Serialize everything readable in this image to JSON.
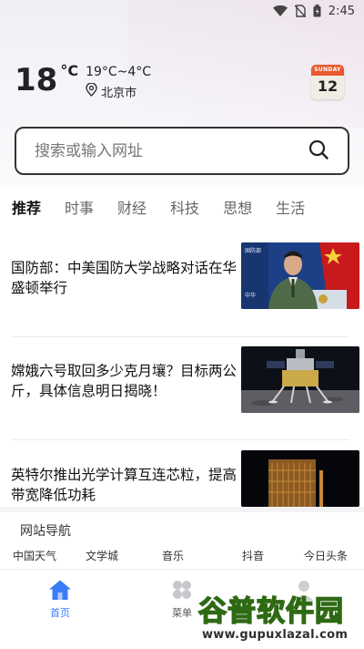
{
  "status_bar": {
    "time": "2:45"
  },
  "weather": {
    "temperature": "18",
    "degree_unit": "°C",
    "range": "19°C~4°C",
    "location": "北京市"
  },
  "calendar": {
    "weekday": "SUNDAY",
    "day": "12"
  },
  "search": {
    "placeholder": "搜索或输入网址"
  },
  "tabs": [
    {
      "label": "推荐",
      "active": true
    },
    {
      "label": "时事",
      "active": false
    },
    {
      "label": "财经",
      "active": false
    },
    {
      "label": "科技",
      "active": false
    },
    {
      "label": "思想",
      "active": false
    },
    {
      "label": "生活",
      "active": false
    }
  ],
  "news": [
    {
      "title": "国防部：中美国防大学战略对话在华盛顿举行",
      "thumb_icon": "press-conference-photo"
    },
    {
      "title": "嫦娥六号取回多少克月壤？目标两公斤，具体信息明日揭晓！",
      "thumb_icon": "lunar-lander-photo"
    },
    {
      "title": "英特尔推出光学计算互连芯粒，提高带宽降低功耗",
      "thumb_icon": "chip-photo"
    }
  ],
  "site_nav": {
    "title": "网站导航",
    "links": [
      "中国天气",
      "文学城",
      "音乐",
      "抖音",
      "今日头条"
    ]
  },
  "bottom_nav": [
    {
      "label": "首页",
      "icon": "home-icon",
      "active": true
    },
    {
      "label": "菜单",
      "icon": "menu-grid-icon",
      "active": false
    },
    {
      "label": "",
      "icon": "user-icon",
      "active": false
    }
  ],
  "watermark": {
    "main": "谷普软件园",
    "sub": "www.gupuxlazal.com"
  },
  "colors": {
    "accent": "#3a7bf6",
    "calendar_header": "#e85a2c",
    "watermark_green": "#6dbb2e"
  }
}
